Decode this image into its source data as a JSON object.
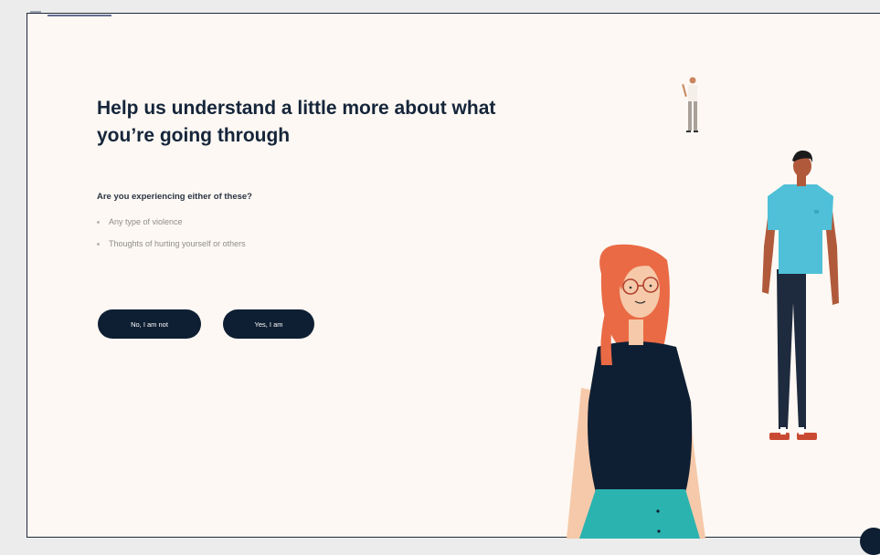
{
  "content": {
    "title": "Help us understand a little more about what you’re going through",
    "question": "Are you experiencing either of these?",
    "items": [
      "Any type of violence",
      "Thoughts of hurting yourself or others"
    ]
  },
  "actions": {
    "no_label": "No, I am not",
    "yes_label": "Yes, I am"
  },
  "colors": {
    "background": "#fdf8f3",
    "button": "#0f1f33",
    "heading": "#15253a"
  },
  "icons": [
    "chat-icon"
  ]
}
